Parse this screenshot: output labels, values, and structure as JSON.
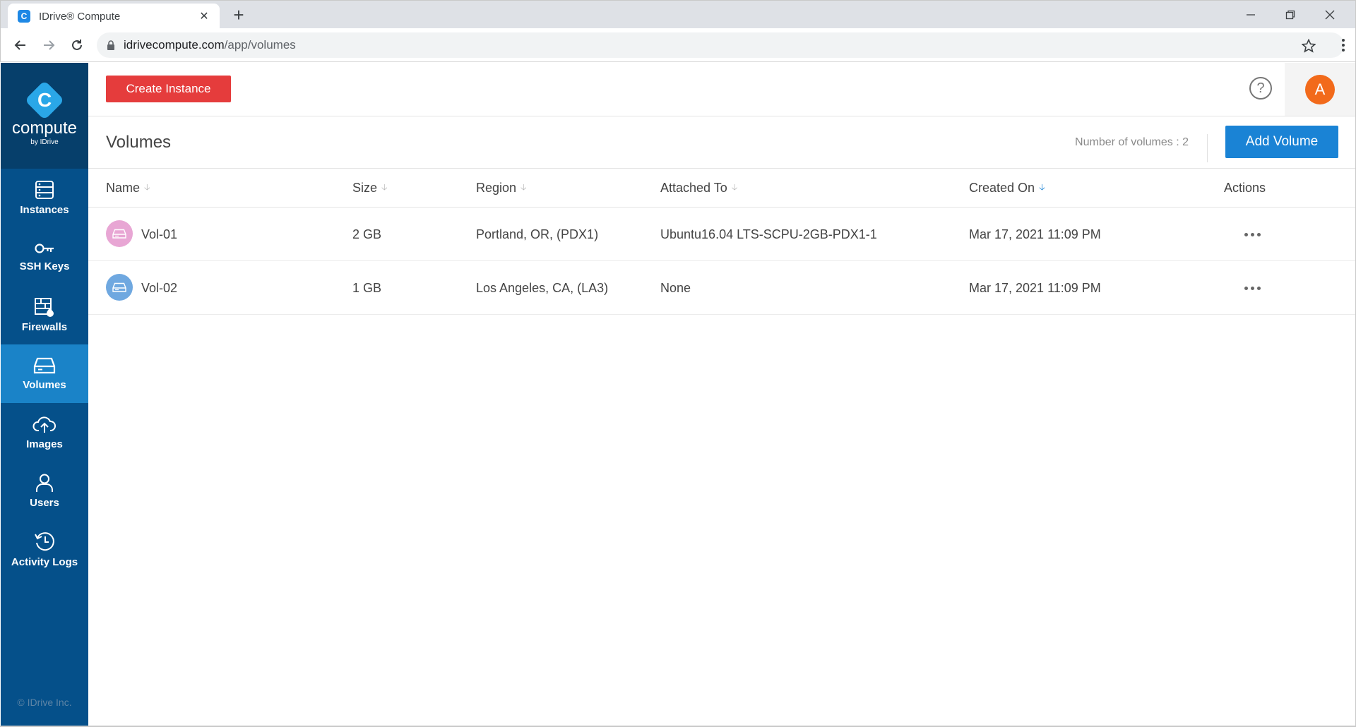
{
  "browser": {
    "tab_title": "IDrive® Compute",
    "tab_favicon_letter": "C",
    "url_host": "idrivecompute.com",
    "url_path": "/app/volumes"
  },
  "sidebar": {
    "logo_text": "compute",
    "logo_sub": "by IDrive",
    "items": [
      {
        "label": "Instances",
        "icon": "instances-icon"
      },
      {
        "label": "SSH Keys",
        "icon": "key-icon"
      },
      {
        "label": "Firewalls",
        "icon": "firewall-icon"
      },
      {
        "label": "Volumes",
        "icon": "volume-icon",
        "active": true
      },
      {
        "label": "Images",
        "icon": "cloud-upload-icon"
      },
      {
        "label": "Users",
        "icon": "user-icon"
      },
      {
        "label": "Activity Logs",
        "icon": "history-icon"
      }
    ],
    "copyright": "© IDrive Inc."
  },
  "topbar": {
    "create_label": "Create Instance",
    "help_symbol": "?",
    "avatar_initial": "A"
  },
  "page": {
    "title": "Volumes",
    "count_label": "Number of volumes : 2",
    "add_label": "Add Volume"
  },
  "table": {
    "columns": [
      "Name",
      "Size",
      "Region",
      "Attached To",
      "Created On",
      "Actions"
    ],
    "sorted_column": "Created On",
    "rows": [
      {
        "name": "Vol-01",
        "size": "2 GB",
        "region": "Portland, OR, (PDX1)",
        "attached": "Ubuntu16.04 LTS-SCPU-2GB-PDX1-1",
        "created": "Mar 17, 2021 11:09 PM",
        "icon_color": "#e8a6d4"
      },
      {
        "name": "Vol-02",
        "size": "1 GB",
        "region": "Los Angeles, CA, (LA3)",
        "attached": "None",
        "created": "Mar 17, 2021 11:09 PM",
        "icon_color": "#6fa8e0"
      }
    ]
  },
  "colors": {
    "sidebar": "#05508a",
    "sidebar_active": "#1a83c8",
    "create_button": "#e53c3c",
    "add_button": "#1a83d5",
    "avatar": "#f26a1b"
  }
}
